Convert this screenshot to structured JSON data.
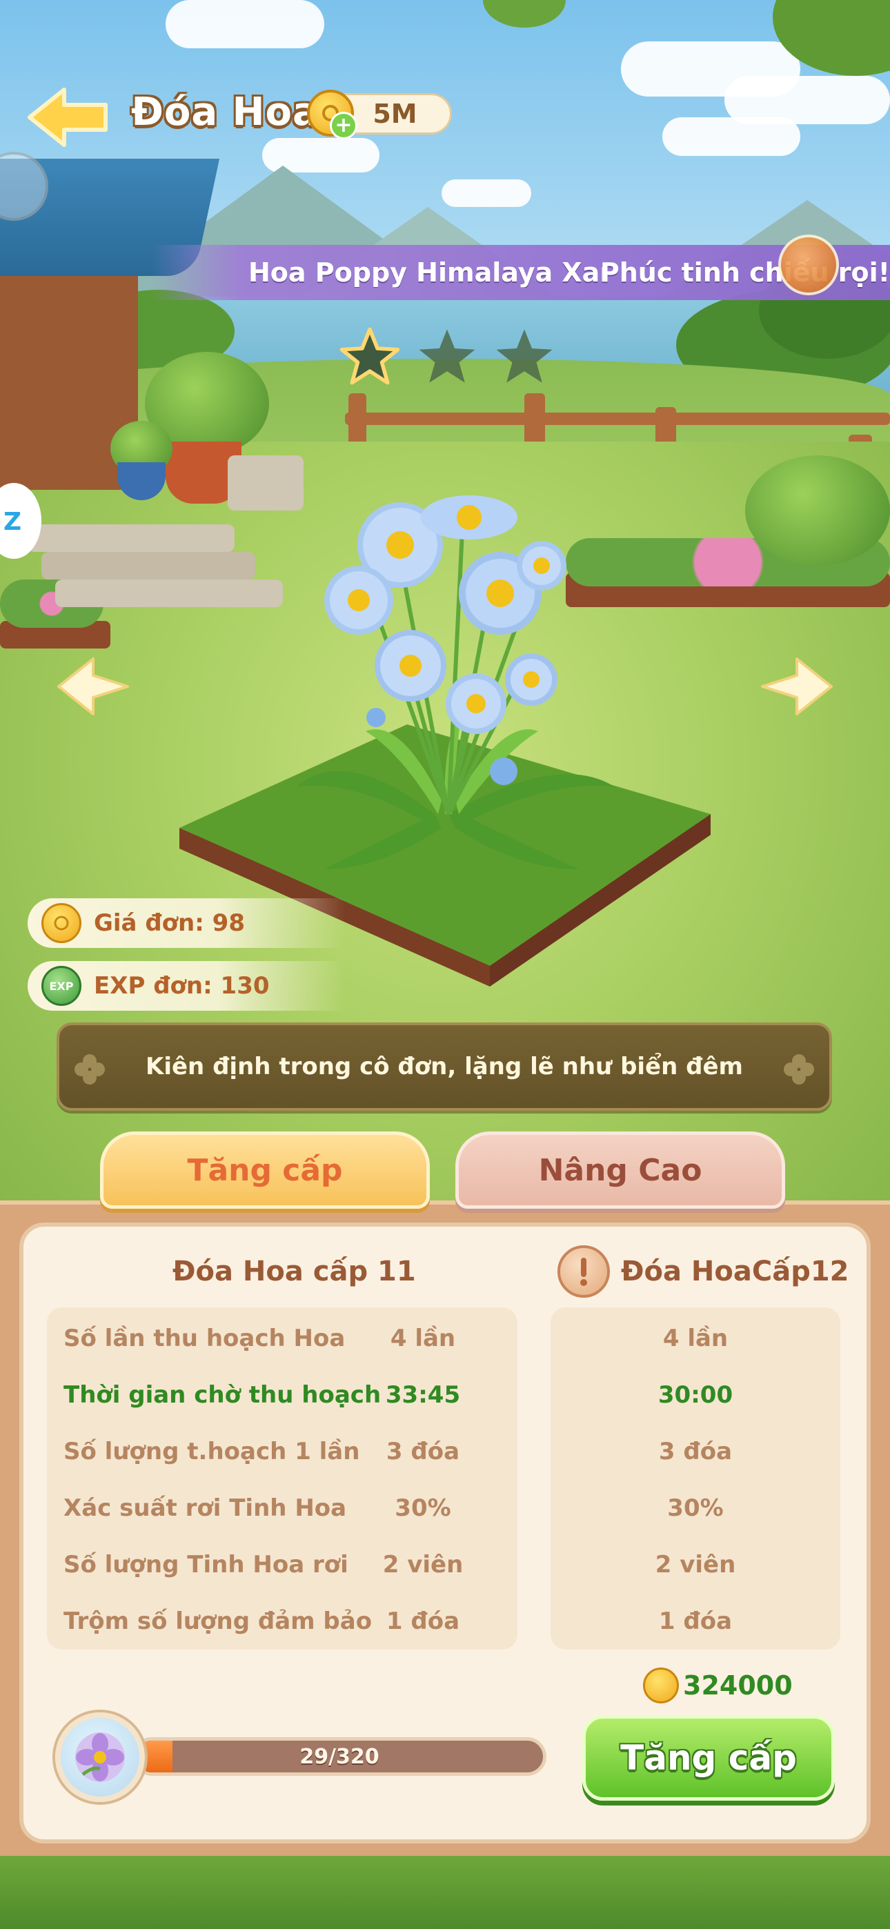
{
  "header": {
    "title": "Đóa Hoa",
    "currency_amount": "5M",
    "back_icon": "back-arrow-icon",
    "coin_icon": "gold-coin-icon",
    "add_icon": "plus-icon"
  },
  "banner": {
    "flower_name": "Hoa Poppy Himalaya Xanh",
    "blessing": "Phúc tinh chiếu rọi!"
  },
  "stars": {
    "filled": 0,
    "total": 3
  },
  "stats": {
    "price_label": "Giá đơn: 98",
    "exp_label": "EXP đơn: 130",
    "exp_icon_text": "EXP"
  },
  "quote": "Kiên định trong cô đơn, lặng lẽ như biển đêm",
  "tabs": {
    "upgrade": "Tăng cấp",
    "advanced": "Nâng Cao"
  },
  "current": {
    "title": "Đóa Hoa cấp 11",
    "rows": [
      {
        "label": "Số lần thu hoạch Hoa",
        "value": "4  lần"
      },
      {
        "label": "Thời gian chờ thu hoạch",
        "value": "33:45"
      },
      {
        "label": "Số lượng t.hoạch 1 lần",
        "value": "3  đóa"
      },
      {
        "label": "Xác suất rơi Tinh Hoa",
        "value": "30%"
      },
      {
        "label": "Số lượng Tinh Hoa rơi",
        "value": "2  viên"
      },
      {
        "label": "Trộm số lượng đảm bảo",
        "value": "1  đóa"
      }
    ]
  },
  "next": {
    "title": "Đóa HoaCấp12",
    "rows": [
      "4 lần",
      "30:00",
      "3  đóa",
      "30%",
      "2  viên",
      "1  đóa"
    ]
  },
  "cost": "324000",
  "progress": {
    "text": "29/320",
    "current": 29,
    "max": 320
  },
  "upgrade_button": "Tăng cấp",
  "colors": {
    "highlight_green": "#2f8a22",
    "label_brown": "#b58560",
    "tab_active_text": "#e56a35",
    "tab_inactive_text": "#9a4e3a",
    "progress_fill": "#ec6a16",
    "button_green": "#5fc22a"
  }
}
